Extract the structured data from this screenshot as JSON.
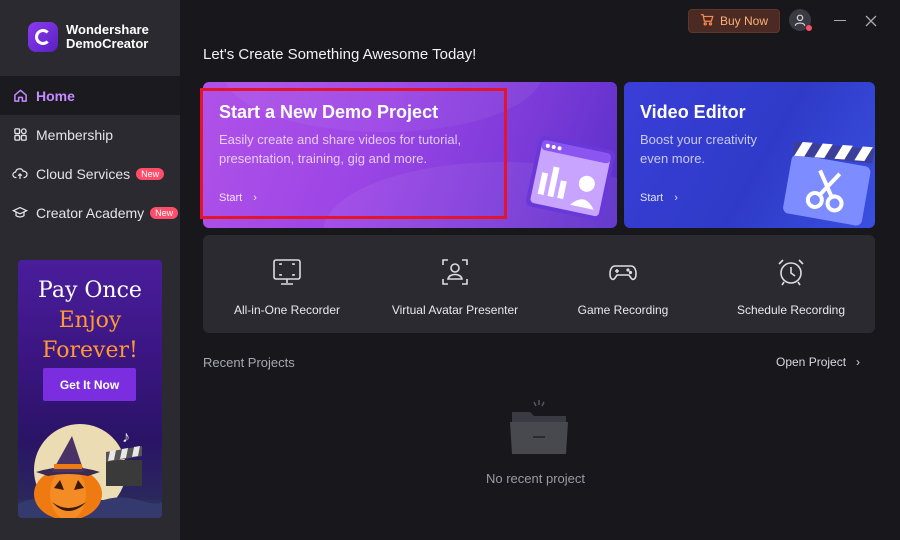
{
  "app": {
    "name_line1": "Wondershare",
    "name_line2": "DemoCreator"
  },
  "topbar": {
    "buy_now": "Buy Now"
  },
  "sidebar": {
    "items": [
      {
        "label": "Home",
        "icon": "home-icon",
        "active": true
      },
      {
        "label": "Membership",
        "icon": "grid-icon",
        "active": false
      },
      {
        "label": "Cloud Services",
        "icon": "cloud-icon",
        "badge": "New",
        "active": false
      },
      {
        "label": "Creator Academy",
        "icon": "academy-icon",
        "badge": "New",
        "active": false
      }
    ]
  },
  "promo": {
    "line1": "Pay Once",
    "line2": "Enjoy",
    "line3": "Forever!",
    "button": "Get It Now"
  },
  "main": {
    "greeting": "Let's Create Something Awesome Today!",
    "demo_card": {
      "title": "Start a New Demo Project",
      "desc_line1": "Easily create and share videos for tutorial,",
      "desc_line2": "presentation, training, gig and more.",
      "start": "Start"
    },
    "editor_card": {
      "title": "Video Editor",
      "desc_line1": "Boost your creativity",
      "desc_line2": "even more.",
      "start": "Start"
    },
    "tools": [
      {
        "label": "All-in-One Recorder",
        "icon": "screen-record-icon"
      },
      {
        "label": "Virtual Avatar Presenter",
        "icon": "avatar-presenter-icon"
      },
      {
        "label": "Game Recording",
        "icon": "gamepad-icon"
      },
      {
        "label": "Schedule Recording",
        "icon": "alarm-clock-icon"
      }
    ],
    "recent": {
      "title": "Recent Projects",
      "open_project": "Open Project",
      "empty": "No recent project"
    }
  },
  "colors": {
    "accent": "#c48cff",
    "sidebar_bg": "#2a2a30",
    "page_bg": "#17171c",
    "badge": "#ff4d6a",
    "highlight": "#e4142c"
  }
}
